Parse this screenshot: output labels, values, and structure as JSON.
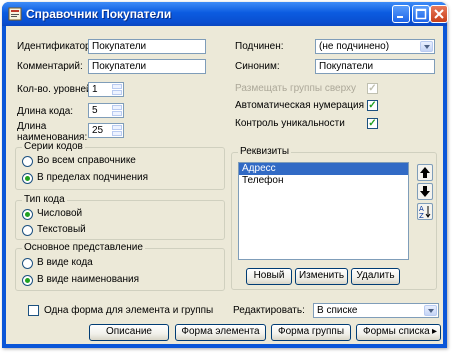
{
  "window": {
    "title": "Справочник Покупатели"
  },
  "fields": {
    "identifier": {
      "label": "Идентификатор:",
      "value": "Покупатели"
    },
    "comment": {
      "label": "Комментарий:",
      "value": "Покупатели"
    },
    "levels": {
      "label": "Кол-во. уровней",
      "value": "1"
    },
    "code_length": {
      "label": "Длина кода:",
      "value": "5"
    },
    "name_length": {
      "label_line1": "Длина",
      "label_line2": "наименования:",
      "value": "25"
    },
    "subordinate": {
      "label": "Подчинен:",
      "value": "(не подчинено)"
    },
    "synonym": {
      "label": "Синоним:",
      "value": "Покупатели"
    }
  },
  "options": {
    "groups_on_top": {
      "label": "Размещать группы сверху",
      "checked": true,
      "enabled": false
    },
    "auto_numbering": {
      "label": "Автоматическая нумерация",
      "checked": true
    },
    "uniqueness": {
      "label": "Контроль уникальности",
      "checked": true
    }
  },
  "code_series": {
    "title": "Серии кодов",
    "options": [
      "Во всем справочнике",
      "В пределах подчинения"
    ],
    "selected": 1
  },
  "code_type": {
    "title": "Тип кода",
    "options": [
      "Числовой",
      "Текстовый"
    ],
    "selected": 0
  },
  "main_view": {
    "title": "Основное представление",
    "options": [
      "В виде кода",
      "В виде наименования"
    ],
    "selected": 1
  },
  "requisites": {
    "title": "Реквизиты",
    "items": [
      "Адресс",
      "Телефон"
    ],
    "selected": 0,
    "buttons": {
      "new": "Новый",
      "edit": "Изменить",
      "delete": "Удалить"
    }
  },
  "bottom": {
    "one_form": {
      "label": "Одна форма для элемента и группы",
      "checked": false
    },
    "edit_label": "Редактировать:",
    "edit_value": "В списке"
  },
  "buttons": {
    "description": "Описание",
    "element_form": "Форма элемента",
    "group_form": "Форма группы",
    "list_forms": "Формы списка"
  }
}
